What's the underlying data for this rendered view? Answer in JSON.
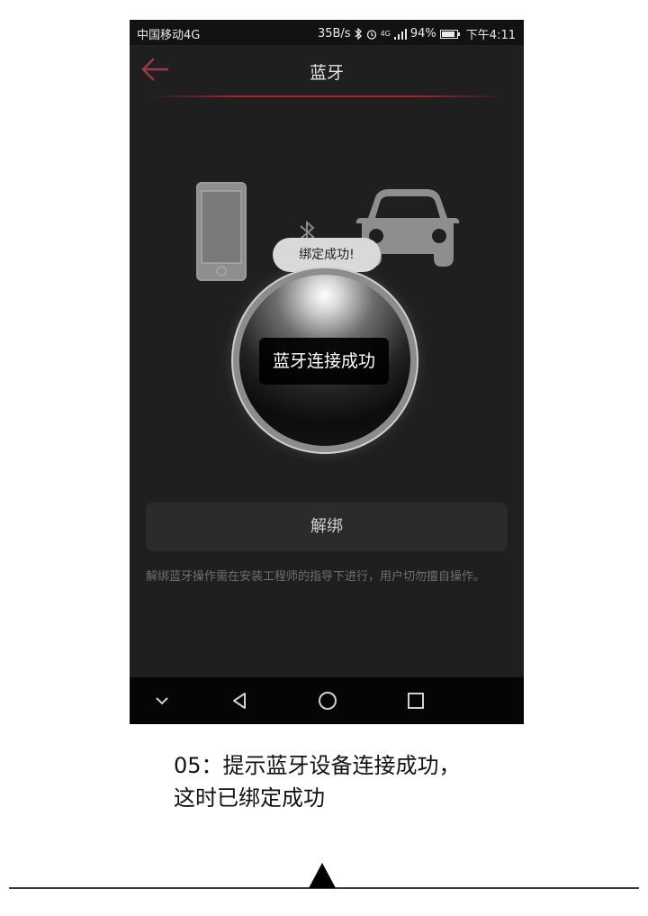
{
  "status": {
    "carrier": "中国移动4G",
    "speed": "35B/s",
    "network": "4G",
    "battery": "94%",
    "time": "下午4:11"
  },
  "header": {
    "title": "蓝牙"
  },
  "toast": {
    "text": "绑定成功!"
  },
  "orb": {
    "label": "蓝牙连接成功"
  },
  "unbind_button": {
    "label": "解绑"
  },
  "note": {
    "text": "解绑蓝牙操作需在安装工程师的指导下进行，用户切勿擅自操作。"
  },
  "caption": {
    "line1": "05：提示蓝牙设备连接成功，",
    "line2": "这时已绑定成功"
  },
  "colors": {
    "accent": "#b0202c",
    "background": "#1f1f20",
    "text": "#e6e6e6"
  },
  "icons": [
    "back-arrow-icon",
    "bluetooth-icon",
    "alarm-icon",
    "signal-icon",
    "battery-icon",
    "smartphone-icon",
    "car-icon",
    "nav-hide-icon",
    "nav-back-icon",
    "nav-home-icon",
    "nav-recents-icon"
  ]
}
